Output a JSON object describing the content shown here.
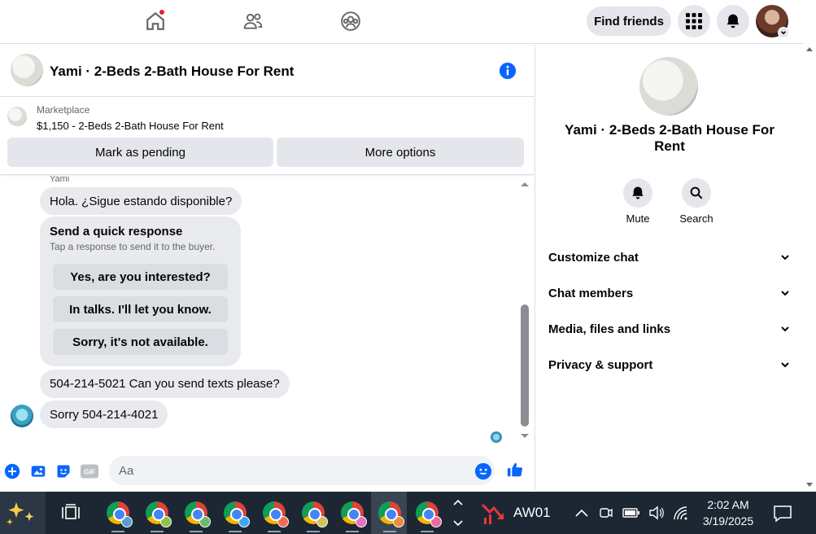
{
  "nav": {
    "find_friends_label": "Find friends"
  },
  "chat": {
    "title": "Yami · 2-Beds 2-Bath House For Rent",
    "marketplace_label": "Marketplace",
    "listing_price_title": "$1,150 - 2-Beds 2-Bath House For Rent",
    "mark_pending_label": "Mark as pending",
    "more_options_label": "More options",
    "sender_name": "Yami",
    "messages": [
      {
        "text": "Hola. ¿Sigue estando disponible?"
      },
      {
        "text": "504-214-5021 Can you send texts please?"
      },
      {
        "text": "Sorry 504-214-4021"
      }
    ],
    "quick_response": {
      "title": "Send a quick response",
      "subtitle": "Tap a response to send it to the buyer.",
      "options": [
        "Yes, are you interested?",
        "In talks. I'll let you know.",
        "Sorry, it's not available."
      ]
    },
    "composer_placeholder": "Aa"
  },
  "side_panel": {
    "title": "Yami · 2-Beds 2-Bath House For Rent",
    "actions": [
      {
        "label": "Mute",
        "icon": "bell-icon"
      },
      {
        "label": "Search",
        "icon": "search-icon"
      }
    ],
    "sections": [
      "Customize chat",
      "Chat members",
      "Media, files and links",
      "Privacy & support"
    ]
  },
  "taskbar": {
    "aw_label": "AW01",
    "time": "2:02 AM",
    "date": "3/19/2025"
  },
  "colors": {
    "accent": "#0866ff",
    "notification_dot": "#e41e3f",
    "bubble": "#e9eaed",
    "taskbar": "#1c2733"
  }
}
